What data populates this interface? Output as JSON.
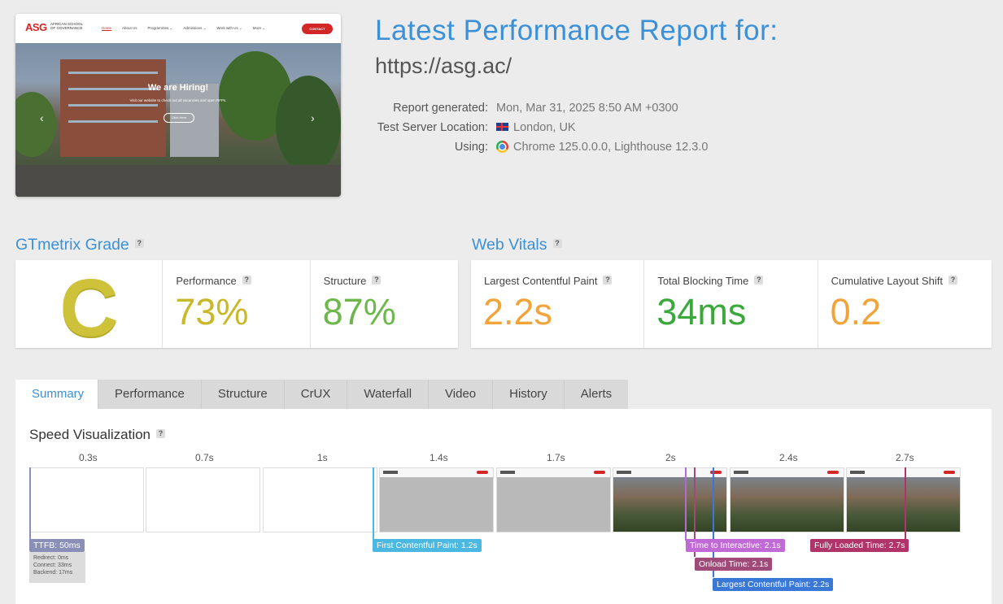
{
  "thumbnail": {
    "logo_text": "ASG",
    "logo_sub": "AFRICAN SCHOOL OF GOVERNANCE",
    "menu": [
      "Home",
      "About Us",
      "Programmes ⌄",
      "Admissions ⌄",
      "Work with Us ⌄",
      "More ⌄"
    ],
    "contact": "CONTACT",
    "hero_title": "We are Hiring!",
    "hero_sub": "Visit our website to check out all vacancies and open RFPs.",
    "hero_button": "Click Here"
  },
  "header": {
    "title": "Latest Performance Report for:",
    "url": "https://asg.ac/",
    "report_generated_label": "Report generated:",
    "report_generated_value": "Mon, Mar 31, 2025 8:50 AM +0300",
    "location_label": "Test Server Location:",
    "location_value": "London, UK",
    "using_label": "Using:",
    "using_value": "Chrome 125.0.0.0, Lighthouse 12.3.0"
  },
  "gtmetrix": {
    "heading": "GTmetrix Grade",
    "grade": "C",
    "performance_label": "Performance",
    "performance_value": "73%",
    "structure_label": "Structure",
    "structure_value": "87%"
  },
  "web_vitals": {
    "heading": "Web Vitals",
    "lcp_label": "Largest Contentful Paint",
    "lcp_value": "2.2s",
    "tbt_label": "Total Blocking Time",
    "tbt_value": "34ms",
    "cls_label": "Cumulative Layout Shift",
    "cls_value": "0.2"
  },
  "colors": {
    "accent": "#3b90d8",
    "grade_c": "#cdc23a",
    "performance": "#c8b82a",
    "structure": "#6cb84a",
    "lcp": "#f0a43a",
    "tbt": "#3aa83a",
    "cls": "#f0a43a"
  },
  "tabs": [
    "Summary",
    "Performance",
    "Structure",
    "CrUX",
    "Waterfall",
    "Video",
    "History",
    "Alerts"
  ],
  "speed": {
    "title": "Speed Visualization",
    "ticks": [
      "0.3s",
      "0.7s",
      "1s",
      "1.4s",
      "1.7s",
      "2s",
      "2.4s",
      "2.7s"
    ],
    "markers": {
      "ttfb": "TTFB: 50ms",
      "ttfb_redirect": "Redirect: 0ms",
      "ttfb_connect": "Connect: 33ms",
      "ttfb_backend": "Backend: 17ms",
      "fcp": "First Contentful Paint: 1.2s",
      "tti": "Time to Interactive: 2.1s",
      "onload": "Onload Time: 2.1s",
      "lcp": "Largest Contentful Paint: 2.2s",
      "fully_loaded": "Fully Loaded Time: 2.7s"
    }
  },
  "icons": [
    "help-icon",
    "uk-flag-icon",
    "chrome-icon",
    "chevron-left-icon",
    "chevron-right-icon"
  ]
}
